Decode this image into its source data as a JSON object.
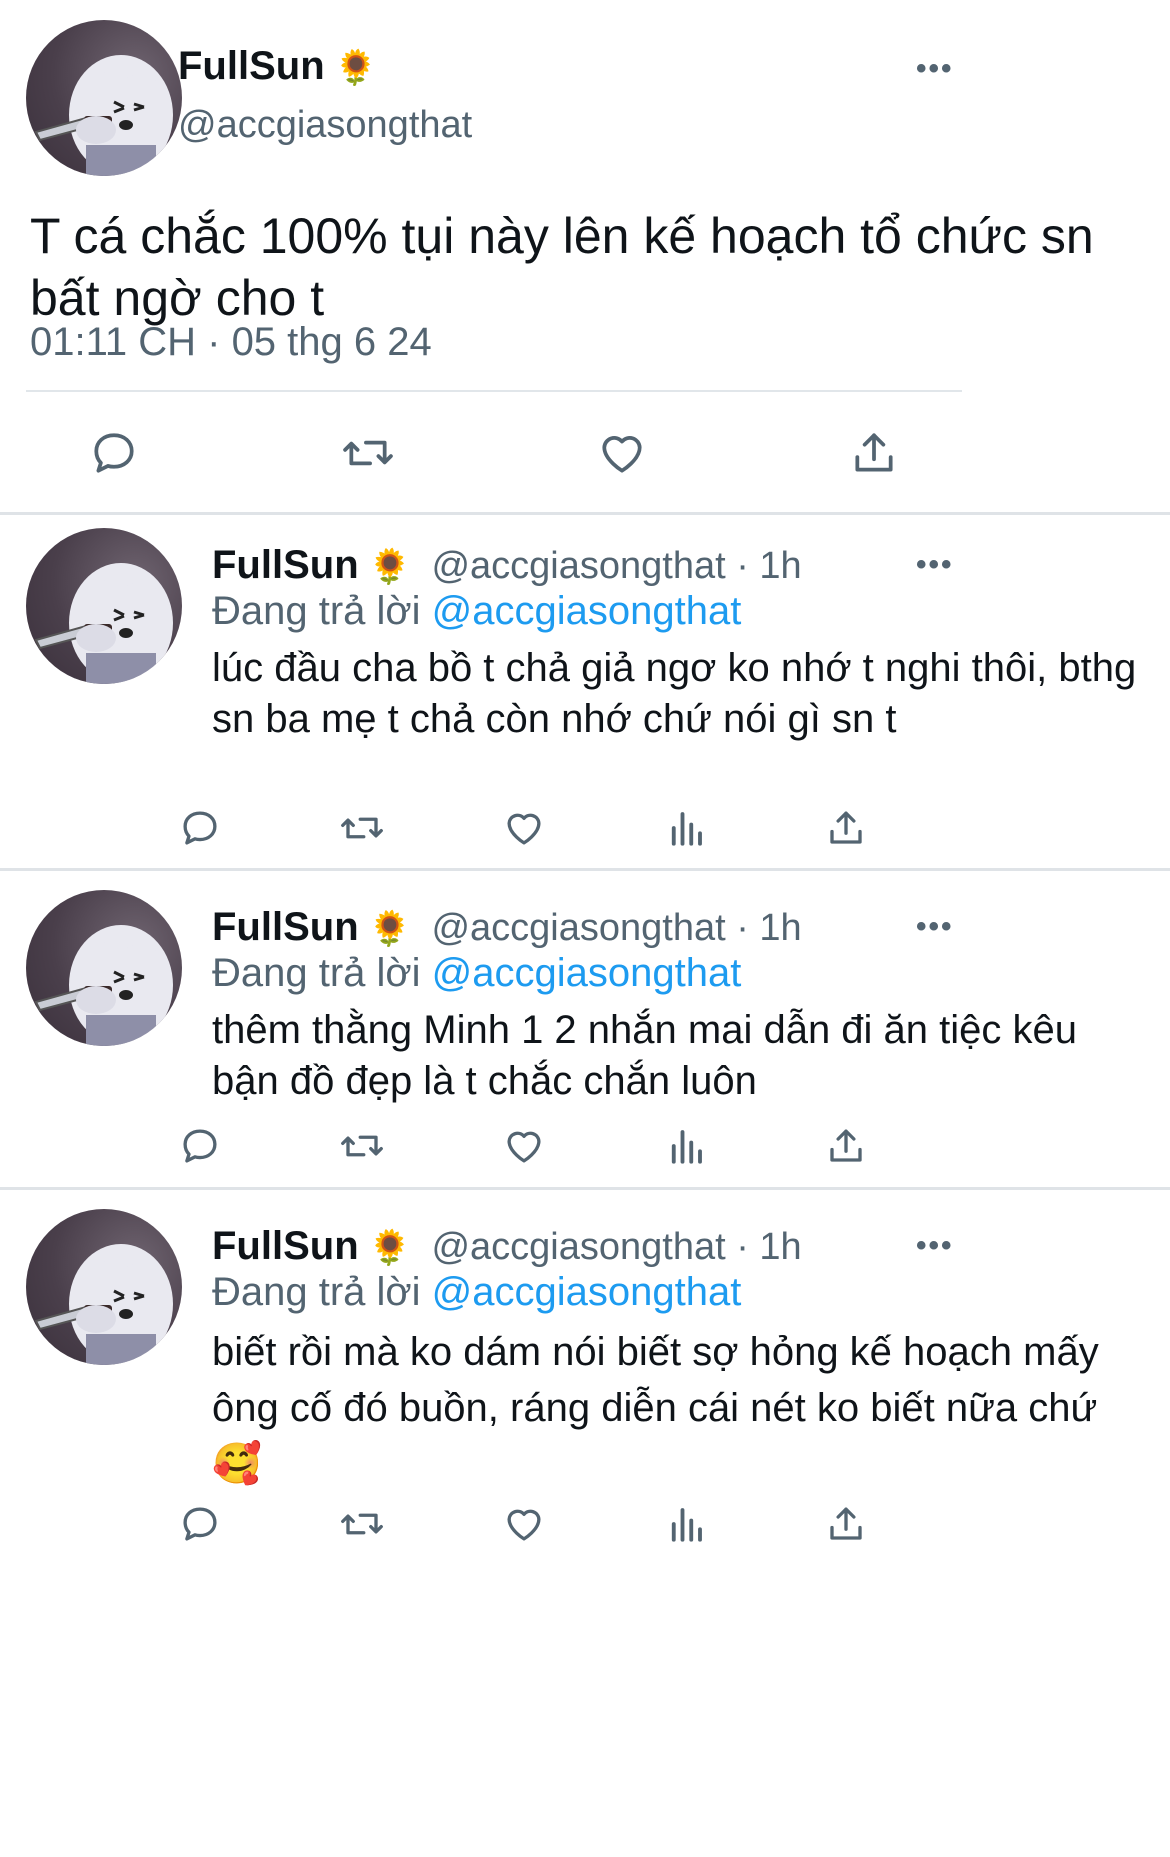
{
  "main_tweet": {
    "name": "FullSun",
    "name_emoji": "🌻",
    "handle": "@accgiasongthat",
    "more": "•••",
    "text": "T cá chắc 100% tụi này lên kế hoạch tổ chức sn bất ngờ cho t",
    "timestamp": "01:11 CH · 05 thg 6 24",
    "icons": [
      "reply-icon",
      "retweet-icon",
      "like-icon",
      "share-icon"
    ]
  },
  "replies": [
    {
      "name": "FullSun",
      "name_emoji": "🌻",
      "handle_time": "@accgiasongthat · 1h",
      "more": "•••",
      "replying_prefix": "Đang trả lời",
      "replying_to": "@accgiasongthat",
      "text": "lúc đầu cha bồ t chả giả ngơ ko nhớ t nghi thôi, bthg sn ba mẹ t chả còn nhớ chứ nói gì sn t"
    },
    {
      "name": "FullSun",
      "name_emoji": "🌻",
      "handle_time": "@accgiasongthat · 1h",
      "more": "•••",
      "replying_prefix": "Đang trả lời",
      "replying_to": "@accgiasongthat",
      "text": "thêm thằng Minh 1 2 nhắn mai dẫn đi ăn tiệc kêu bận đồ đẹp là t chắc chắn luôn"
    },
    {
      "name": "FullSun",
      "name_emoji": "🌻",
      "handle_time": "@accgiasongthat · 1h",
      "more": "•••",
      "replying_prefix": "Đang trả lời",
      "replying_to": "@accgiasongthat",
      "text": "biết rồi mà ko dám nói biết sợ hỏng kế hoạch mấy ông cố đó buồn, ráng diễn cái nét ko biết nữa chứ 🥰"
    }
  ],
  "reply_action_icons": [
    "reply-icon",
    "retweet-icon",
    "like-icon",
    "views-icon",
    "share-icon"
  ],
  "colors": {
    "text": "#0f1419",
    "secondary": "#536471",
    "link": "#1d9bf0",
    "divider": "#e1e6ea"
  }
}
